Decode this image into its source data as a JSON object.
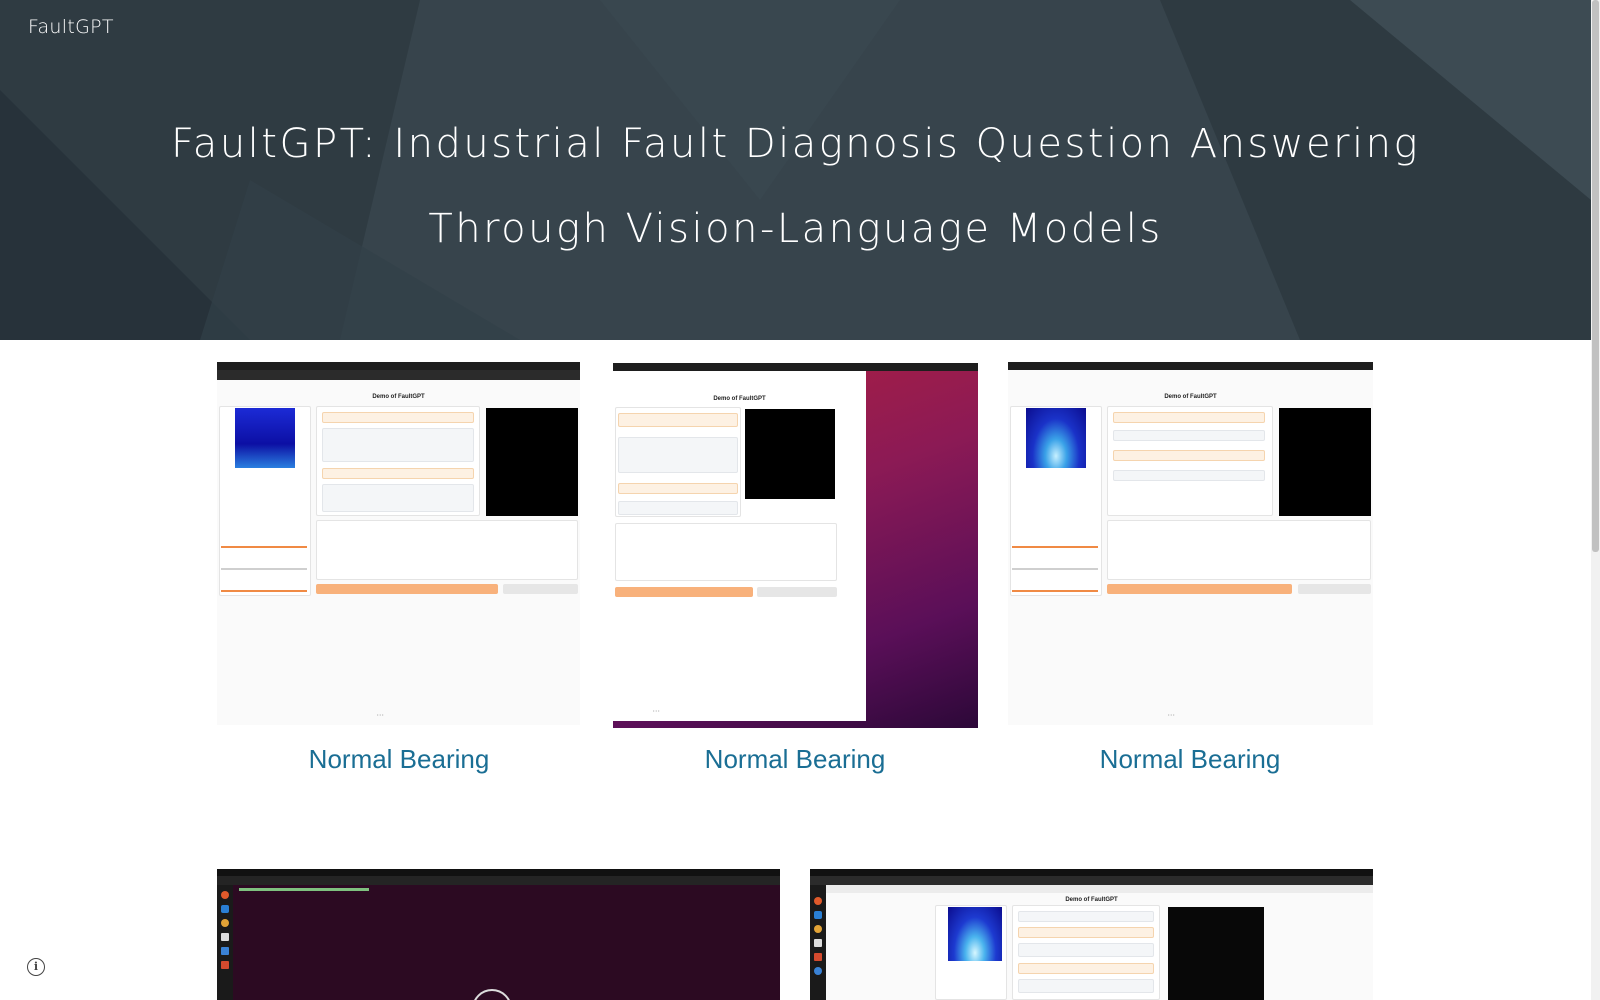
{
  "site": {
    "title": "FaultGPT"
  },
  "hero": {
    "heading": "FaultGPT: Industrial Fault Diagnosis Question Answering Through Vision-Language Models"
  },
  "gallery": {
    "row1": [
      {
        "caption": "Normal Bearing",
        "app_title": "Demo of FaultGPT"
      },
      {
        "caption": "Normal Bearing",
        "app_title": "Demo of FaultGPT"
      },
      {
        "caption": "Normal Bearing",
        "app_title": "Demo of FaultGPT"
      }
    ],
    "row2": [
      {
        "app_title": ""
      },
      {
        "app_title": "Demo of FaultGPT"
      }
    ]
  },
  "icons": {
    "info": "info-icon"
  },
  "colors": {
    "hero_bg": "#37444c",
    "caption": "#1a6e94",
    "accent": "#f08a44"
  }
}
